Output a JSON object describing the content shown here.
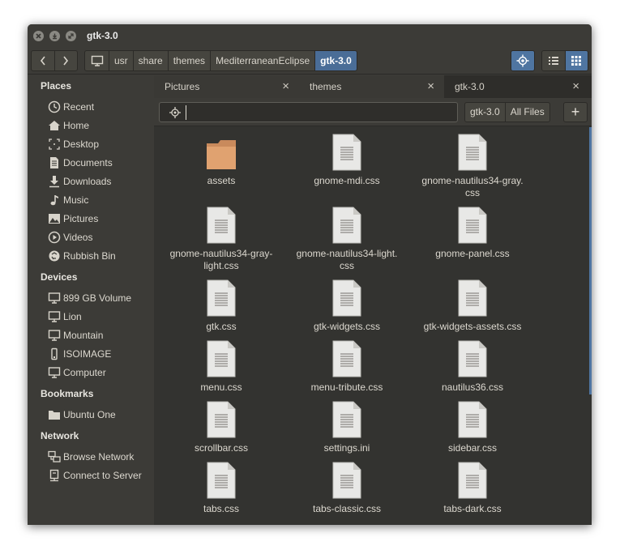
{
  "window": {
    "title": "gtk-3.0"
  },
  "breadcrumbs": [
    "usr",
    "share",
    "themes",
    "MediterraneanEclipse",
    "gtk-3.0"
  ],
  "sidebar": {
    "places_heading": "Places",
    "places": [
      {
        "label": "Recent",
        "icon": "clock-icon"
      },
      {
        "label": "Home",
        "icon": "home-icon"
      },
      {
        "label": "Desktop",
        "icon": "desktop-icon"
      },
      {
        "label": "Documents",
        "icon": "document-icon"
      },
      {
        "label": "Downloads",
        "icon": "download-icon"
      },
      {
        "label": "Music",
        "icon": "music-icon"
      },
      {
        "label": "Pictures",
        "icon": "pictures-icon"
      },
      {
        "label": "Videos",
        "icon": "video-icon"
      },
      {
        "label": "Rubbish Bin",
        "icon": "trash-icon"
      }
    ],
    "devices_heading": "Devices",
    "devices": [
      {
        "label": "899 GB Volume",
        "icon": "drive-icon"
      },
      {
        "label": "Lion",
        "icon": "drive-icon"
      },
      {
        "label": "Mountain",
        "icon": "drive-icon"
      },
      {
        "label": "ISOIMAGE",
        "icon": "usb-icon"
      },
      {
        "label": "Computer",
        "icon": "computer-icon"
      }
    ],
    "bookmarks_heading": "Bookmarks",
    "bookmarks": [
      {
        "label": "Ubuntu One",
        "icon": "folder-icon"
      }
    ],
    "network_heading": "Network",
    "network": [
      {
        "label": "Browse Network",
        "icon": "network-icon"
      },
      {
        "label": "Connect to Server",
        "icon": "server-icon"
      }
    ]
  },
  "tabs": [
    {
      "label": "Pictures",
      "close": "×"
    },
    {
      "label": "themes",
      "close": "×"
    },
    {
      "label": "gtk-3.0",
      "close": "×"
    }
  ],
  "search": {
    "value": "",
    "scope_current": "gtk-3.0",
    "scope_all": "All Files",
    "add_label": "+"
  },
  "files": [
    {
      "name": "assets",
      "type": "folder"
    },
    {
      "name": "gnome-mdi.css",
      "type": "file"
    },
    {
      "name": "gnome-nautilus34-gray.\ncss",
      "type": "file"
    },
    {
      "name": "gnome-nautilus34-gray-\nlight.css",
      "type": "file"
    },
    {
      "name": "gnome-nautilus34-light.\ncss",
      "type": "file"
    },
    {
      "name": "gnome-panel.css",
      "type": "file"
    },
    {
      "name": "gtk.css",
      "type": "file"
    },
    {
      "name": "gtk-widgets.css",
      "type": "file"
    },
    {
      "name": "gtk-widgets-assets.css",
      "type": "file"
    },
    {
      "name": "menu.css",
      "type": "file"
    },
    {
      "name": "menu-tribute.css",
      "type": "file"
    },
    {
      "name": "nautilus36.css",
      "type": "file"
    },
    {
      "name": "scrollbar.css",
      "type": "file"
    },
    {
      "name": "settings.ini",
      "type": "file"
    },
    {
      "name": "sidebar.css",
      "type": "file"
    },
    {
      "name": "tabs.css",
      "type": "file"
    },
    {
      "name": "tabs-classic.css",
      "type": "file"
    },
    {
      "name": "tabs-dark.css",
      "type": "file"
    }
  ],
  "colors": {
    "accent": "#4f75a1",
    "folder": "#e0a270",
    "background": "#333330",
    "chrome": "#3c3b37"
  }
}
